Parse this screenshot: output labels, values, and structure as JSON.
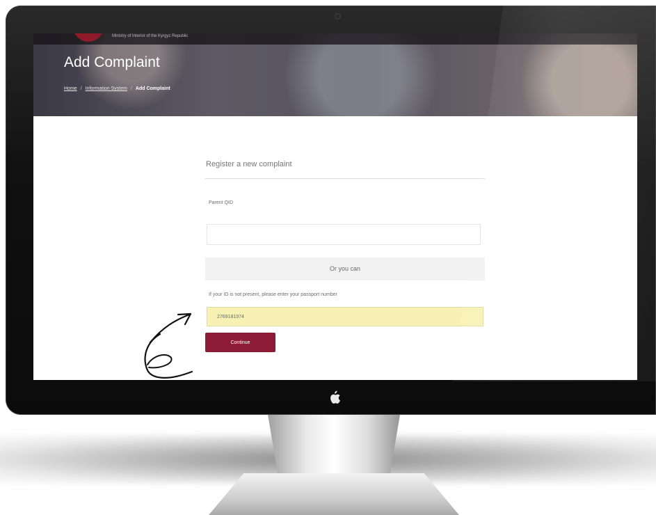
{
  "site": {
    "logo_tagline": "Ministry of Interior of the Kyrgyz Republic"
  },
  "hero": {
    "title": "Add Complaint",
    "breadcrumb": [
      {
        "label": "Home"
      },
      {
        "label": "Information System"
      },
      {
        "label": "Add Complaint"
      }
    ]
  },
  "form": {
    "heading": "Register a new complaint",
    "id_label": "Parent QID",
    "id_value": "",
    "or_text": "Or you can",
    "passport_label": "If your ID is not present, please enter your passport number",
    "passport_value": "2769181974",
    "continue_label": "Continue"
  },
  "colors": {
    "accent": "#8d1b35",
    "highlight_input": "#f7f2b4"
  },
  "icons": [
    "apple-icon",
    "annotation-arrow-icon"
  ]
}
